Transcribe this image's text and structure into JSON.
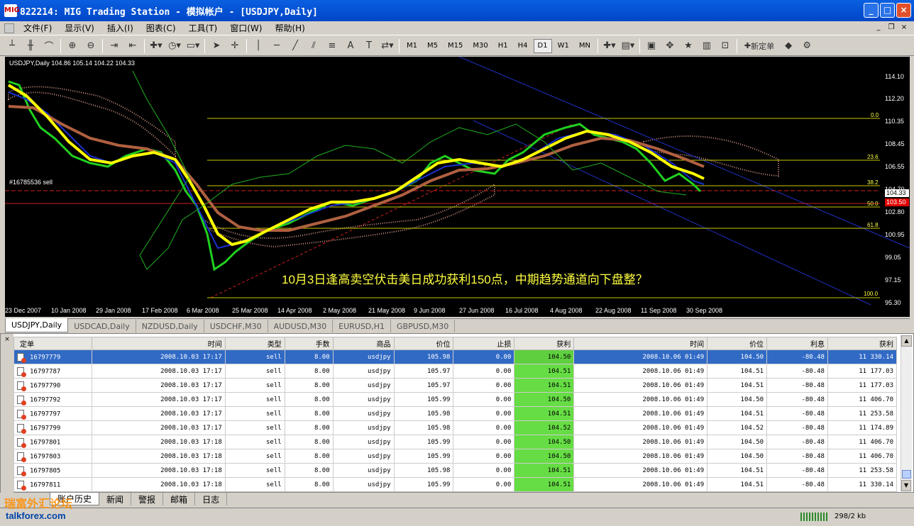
{
  "window": {
    "icon": "MIG",
    "title": "822214: MIG Trading Station - 模拟帐户 - [USDJPY,Daily]"
  },
  "menu": [
    "文件(F)",
    "显示(V)",
    "插入(I)",
    "图表(C)",
    "工具(T)",
    "窗口(W)",
    "帮助(H)"
  ],
  "toolbar": {
    "timeframes": [
      "M1",
      "M5",
      "M15",
      "M30",
      "H1",
      "H4",
      "D1",
      "W1",
      "MN"
    ],
    "active_timeframe": "D1",
    "new_order_label": "新定单"
  },
  "chart": {
    "info": "USDJPY,Daily  104.86 105.14 104.22 104.33",
    "order_label": "#16785536 sell",
    "annotation": "10月3日逢高卖空伏击美日成功获利150点，中期趋势通道向下盘整？",
    "price_labels": [
      "114.10",
      "112.20",
      "110.35",
      "108.45",
      "106.55",
      "104.70",
      "102.80",
      "100.95",
      "99.05",
      "97.15",
      "95.30"
    ],
    "current_price": "104.33",
    "order_price": "103.50",
    "fib_levels": [
      "0.0",
      "23.6",
      "38.2",
      "50.0",
      "61.8",
      "100.0"
    ],
    "date_labels": [
      "23 Dec 2007",
      "10 Jan 2008",
      "29 Jan 2008",
      "17 Feb 2008",
      "6 Mar 2008",
      "25 Mar 2008",
      "14 Apr 2008",
      "2 May 2008",
      "21 May 2008",
      "9 Jun 2008",
      "27 Jun 2008",
      "16 Jul 2008",
      "4 Aug 2008",
      "22 Aug 2008",
      "11 Sep 2008",
      "30 Sep 2008"
    ]
  },
  "chart_tabs": [
    "USDJPY,Daily",
    "USDCAD,Daily",
    "NZDUSD,Daily",
    "USDCHF,M30",
    "AUDUSD,M30",
    "EURUSD,H1",
    "GBPUSD,M30"
  ],
  "table": {
    "headers": [
      "定单",
      "时间",
      "类型",
      "手数",
      "商品",
      "价位",
      "止损",
      "获利",
      "时间",
      "价位",
      "利息",
      "获利"
    ],
    "rows": [
      [
        "16797779",
        "2008.10.03 17:17",
        "sell",
        "8.00",
        "usdjpy",
        "105.98",
        "0.00",
        "104.50",
        "2008.10.06 01:49",
        "104.50",
        "-80.48",
        "11 330.14"
      ],
      [
        "16797787",
        "2008.10.03 17:17",
        "sell",
        "8.00",
        "usdjpy",
        "105.97",
        "0.00",
        "104.51",
        "2008.10.06 01:49",
        "104.51",
        "-80.48",
        "11 177.03"
      ],
      [
        "16797790",
        "2008.10.03 17:17",
        "sell",
        "8.00",
        "usdjpy",
        "105.97",
        "0.00",
        "104.51",
        "2008.10.06 01:49",
        "104.51",
        "-80.48",
        "11 177.03"
      ],
      [
        "16797792",
        "2008.10.03 17:17",
        "sell",
        "8.00",
        "usdjpy",
        "105.99",
        "0.00",
        "104.50",
        "2008.10.06 01:49",
        "104.50",
        "-80.48",
        "11 406.70"
      ],
      [
        "16797797",
        "2008.10.03 17:17",
        "sell",
        "8.00",
        "usdjpy",
        "105.98",
        "0.00",
        "104.51",
        "2008.10.06 01:49",
        "104.51",
        "-80.48",
        "11 253.58"
      ],
      [
        "16797799",
        "2008.10.03 17:17",
        "sell",
        "8.00",
        "usdjpy",
        "105.98",
        "0.00",
        "104.52",
        "2008.10.06 01:49",
        "104.52",
        "-80.48",
        "11 174.89"
      ],
      [
        "16797801",
        "2008.10.03 17:18",
        "sell",
        "8.00",
        "usdjpy",
        "105.99",
        "0.00",
        "104.50",
        "2008.10.06 01:49",
        "104.50",
        "-80.48",
        "11 406.70"
      ],
      [
        "16797803",
        "2008.10.03 17:18",
        "sell",
        "8.00",
        "usdjpy",
        "105.99",
        "0.00",
        "104.50",
        "2008.10.06 01:49",
        "104.50",
        "-80.48",
        "11 406.70"
      ],
      [
        "16797805",
        "2008.10.03 17:18",
        "sell",
        "8.00",
        "usdjpy",
        "105.98",
        "0.00",
        "104.51",
        "2008.10.06 01:49",
        "104.51",
        "-80.48",
        "11 253.58"
      ],
      [
        "16797811",
        "2008.10.03 17:18",
        "sell",
        "8.00",
        "usdjpy",
        "105.99",
        "0.00",
        "104.51",
        "2008.10.06 01:49",
        "104.51",
        "-80.48",
        "11 330.14"
      ]
    ]
  },
  "terminal_tabs": [
    "账户历史",
    "新闻",
    "警报",
    "邮箱",
    "日志"
  ],
  "status": {
    "traffic": "298/2 kb"
  },
  "watermark": {
    "line1": "瑞富外汇论坛",
    "line2": "talkforex.com"
  }
}
